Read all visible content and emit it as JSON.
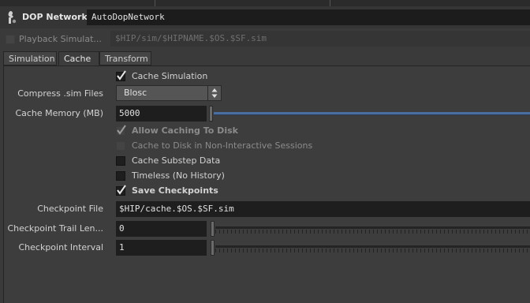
{
  "header": {
    "node_type": "DOP Network",
    "node_name": "AutoDopNetwork",
    "node_icon": "dop-network-icon"
  },
  "playback": {
    "label": "Playback Simulat...",
    "path": "$HIP/sim/$HIPNAME.$OS.$SF.sim",
    "checked": false
  },
  "tabs": [
    {
      "label": "Simulation",
      "active": false
    },
    {
      "label": "Cache",
      "active": true
    },
    {
      "label": "Transform",
      "active": false
    }
  ],
  "cache": {
    "cache_simulation": {
      "label": "Cache Simulation",
      "checked": true
    },
    "compress": {
      "label": "Compress .sim Files",
      "value": "Blosc"
    },
    "memory": {
      "label": "Cache Memory (MB)",
      "value": "5000",
      "slider_fraction": 1.0
    },
    "allow_caching": {
      "label": "Allow Caching To Disk",
      "checked": true,
      "enabled": false
    },
    "non_interactive": {
      "label": "Cache to Disk in Non-Interactive Sessions",
      "checked": false,
      "enabled": false
    },
    "substep": {
      "label": "Cache Substep Data",
      "checked": false
    },
    "timeless": {
      "label": "Timeless (No History)",
      "checked": false
    },
    "save_checkpoints": {
      "label": "Save Checkpoints",
      "checked": true
    },
    "checkpoint_file": {
      "label": "Checkpoint File",
      "value": "$HIP/cache.$OS.$SF.sim"
    },
    "trail_length": {
      "label": "Checkpoint Trail Len...",
      "value": "0"
    },
    "interval": {
      "label": "Checkpoint Interval",
      "value": "1"
    }
  },
  "colors": {
    "background": "#3a3a3a",
    "field": "#1e1e1e",
    "accent_slider": "#4a6ea0"
  }
}
